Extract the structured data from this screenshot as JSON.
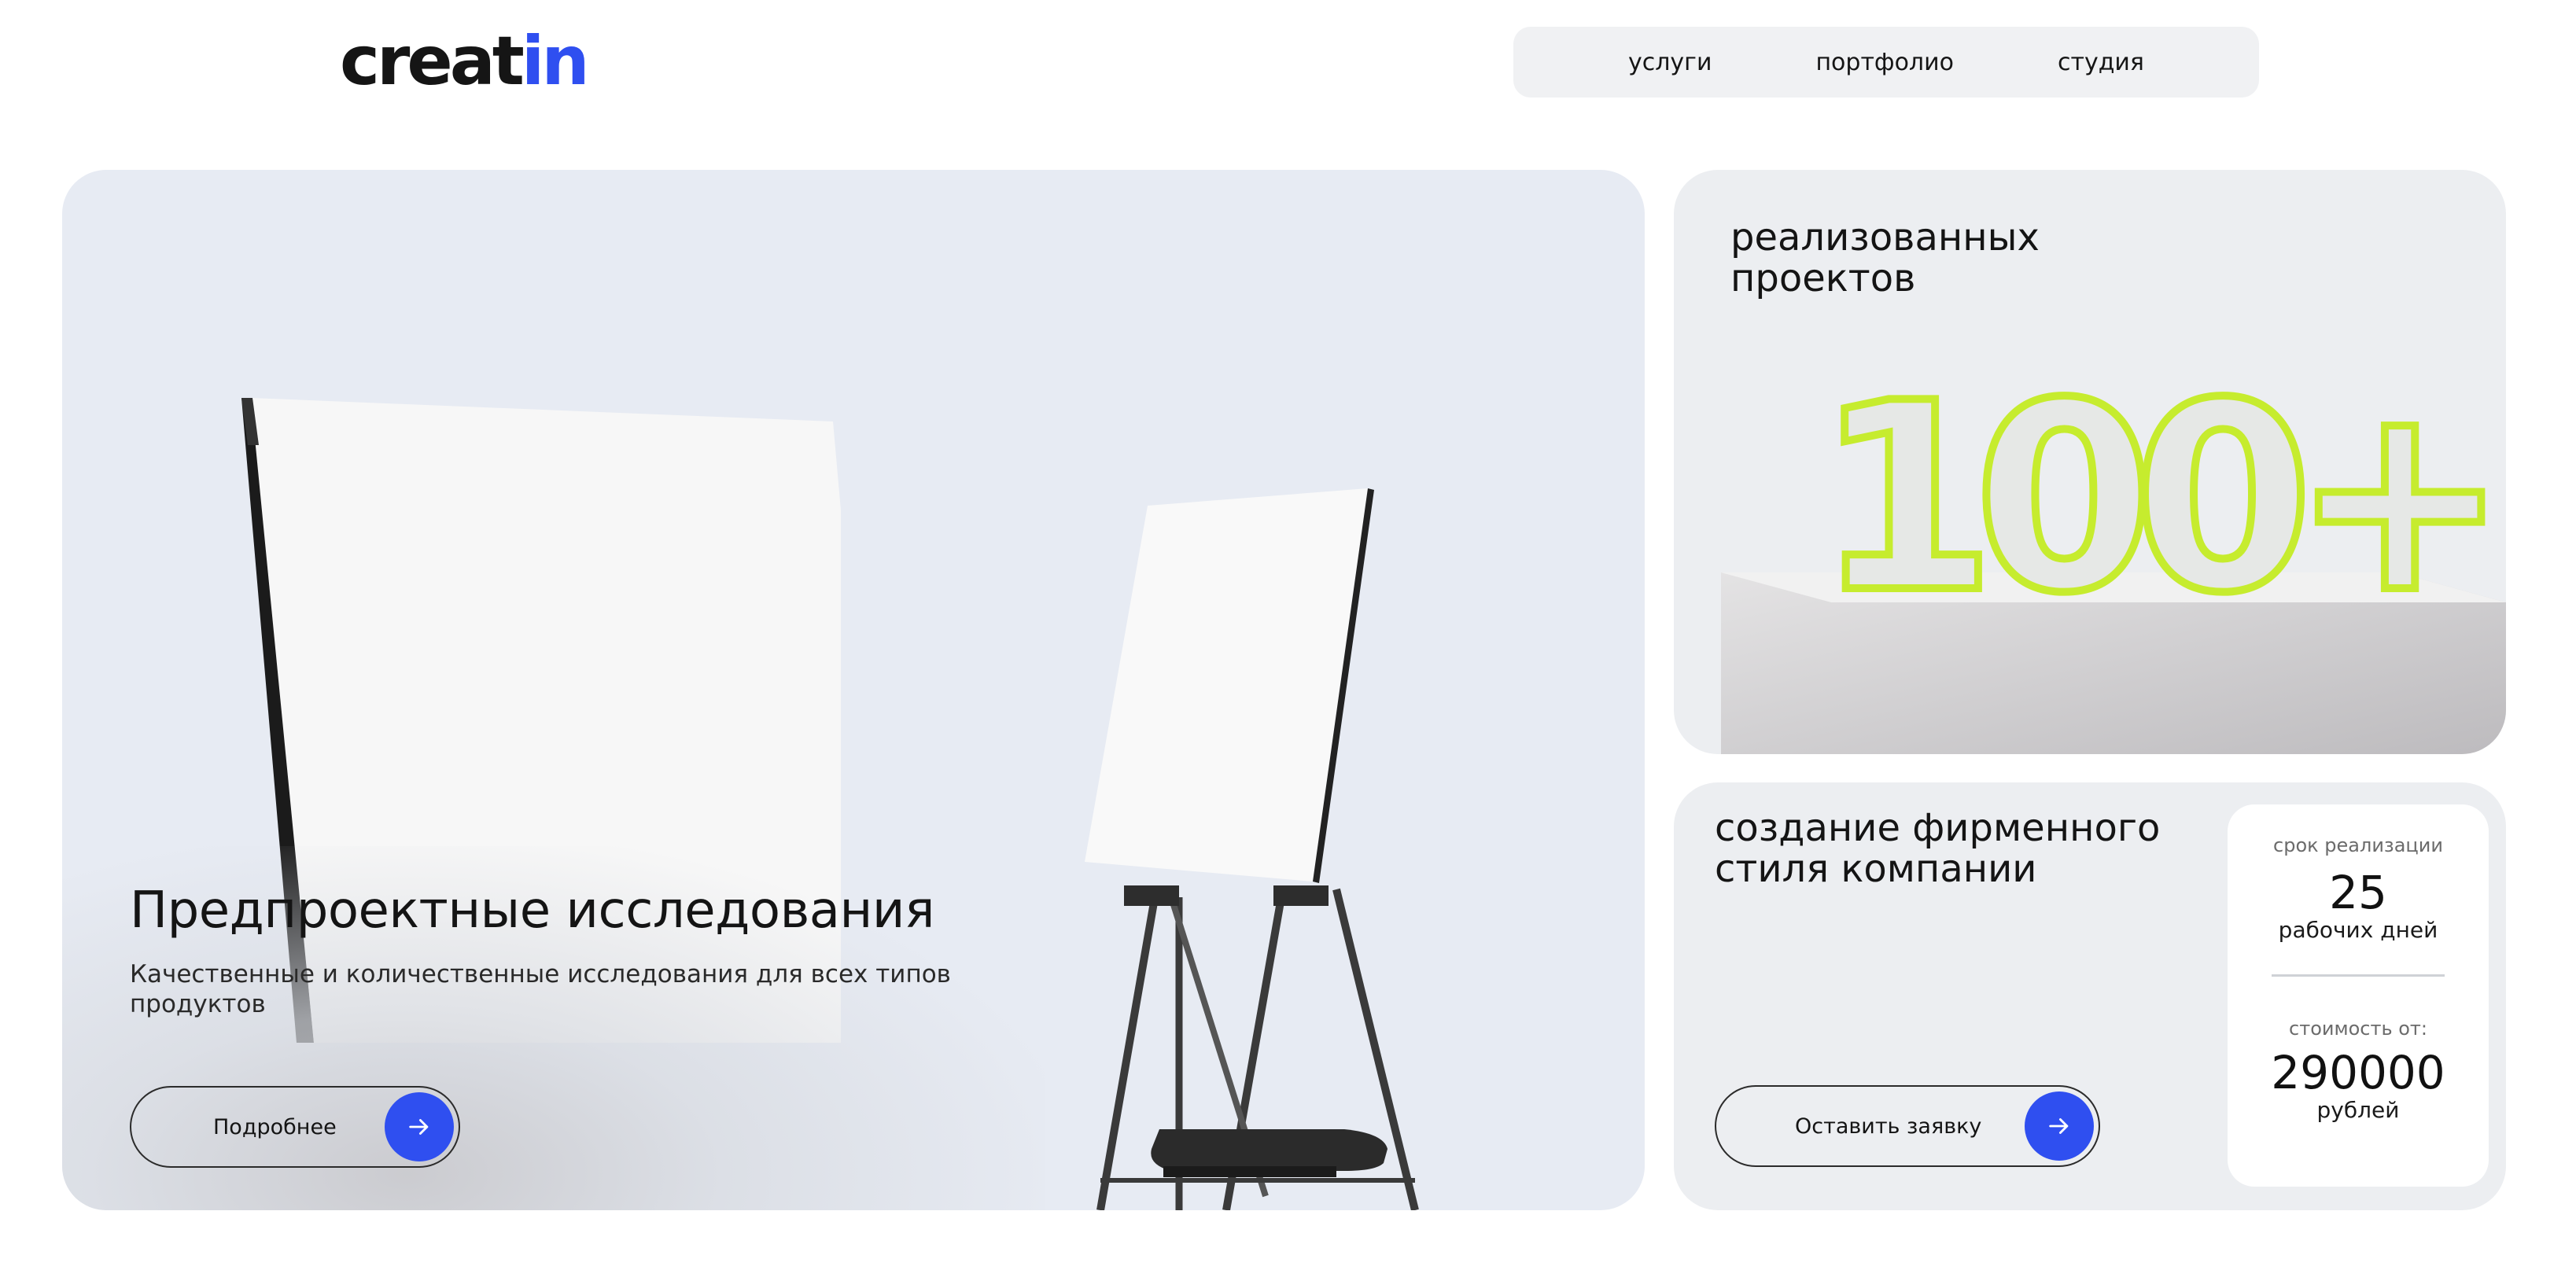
{
  "header": {
    "logo_part1": "creat",
    "logo_part2": "in",
    "nav": [
      {
        "label": "услуги"
      },
      {
        "label": "портфолио"
      },
      {
        "label": "студия"
      }
    ]
  },
  "hero": {
    "title": "Предпроектные исследования",
    "description": "Качественные и количественные исследования для всех типов продуктов",
    "button_label": "Подробнее",
    "button_icon": "arrow-right-icon"
  },
  "projects": {
    "label": "реализованных проектов",
    "stat": "100+",
    "accent_color": "#c6ec2e"
  },
  "branding": {
    "title": "создание фирменного стиля компании",
    "button_label": "Оставить заявку",
    "button_icon": "arrow-right-icon",
    "term_label": "срок реализации",
    "term_value": "25",
    "term_unit": "рабочих дней",
    "price_label": "стоимость от:",
    "price_value": "290000",
    "price_unit": "рублей"
  },
  "colors": {
    "brand_blue": "#2f4ff0",
    "hero_bg": "#e7ebf3",
    "card_bg": "#eceef1"
  }
}
